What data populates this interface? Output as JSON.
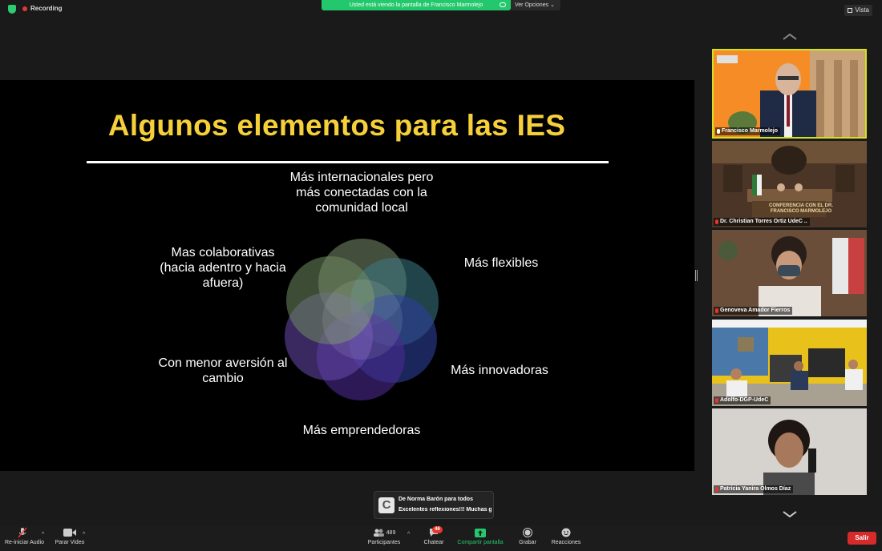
{
  "topbar": {
    "recording_label": "Recording",
    "share_banner": "Usted está viendo la pantalla de Francisco Marmolejo",
    "view_options": "Ver Opciones",
    "view_label": "Vista"
  },
  "slide": {
    "title": "Algunos elementos para las IES",
    "labels": {
      "top": "Más internacionales pero más conectadas con la comunidad local",
      "right_top": "Más flexibles",
      "left_top": "Mas colaborativas (hacia adentro y hacia afuera)",
      "left_bottom": "Con menor aversión al cambio",
      "right_bottom": "Más innovadoras",
      "bottom": "Más emprendedoras"
    }
  },
  "gallery": {
    "participants": [
      {
        "name": "Francisco Marmolejo"
      },
      {
        "name": "Dr. Christian Torres Ortiz UdeC .."
      },
      {
        "name": "Genoveva Amador Fierros"
      },
      {
        "name": "Adolfo-DGP-UdeC"
      },
      {
        "name": "Patricia Yanira Olmos Díaz"
      }
    ],
    "tile2_sign": "CONFERENCIA CON EL DR. FRANCISCO MARMOLEJO"
  },
  "chat_toast": {
    "avatar_letter": "C",
    "from": "De Norma Barón para todos",
    "message": "Excelentes reflexiones!!! Muchas g..."
  },
  "toolbar": {
    "audio_label": "Re-iniciar Audio",
    "video_label": "Parar Video",
    "participants_label": "Participantes",
    "participants_count": "489",
    "chat_label": "Chatear",
    "chat_badge": "46",
    "share_label": "Compartir pantalla",
    "record_label": "Grabar",
    "reactions_label": "Reacciones",
    "leave_label": "Salir"
  },
  "colors": {
    "accent_green": "#23c86d",
    "title_yellow": "#f6d03a",
    "leave_red": "#d62b2b",
    "active_border": "#d4e21c"
  }
}
